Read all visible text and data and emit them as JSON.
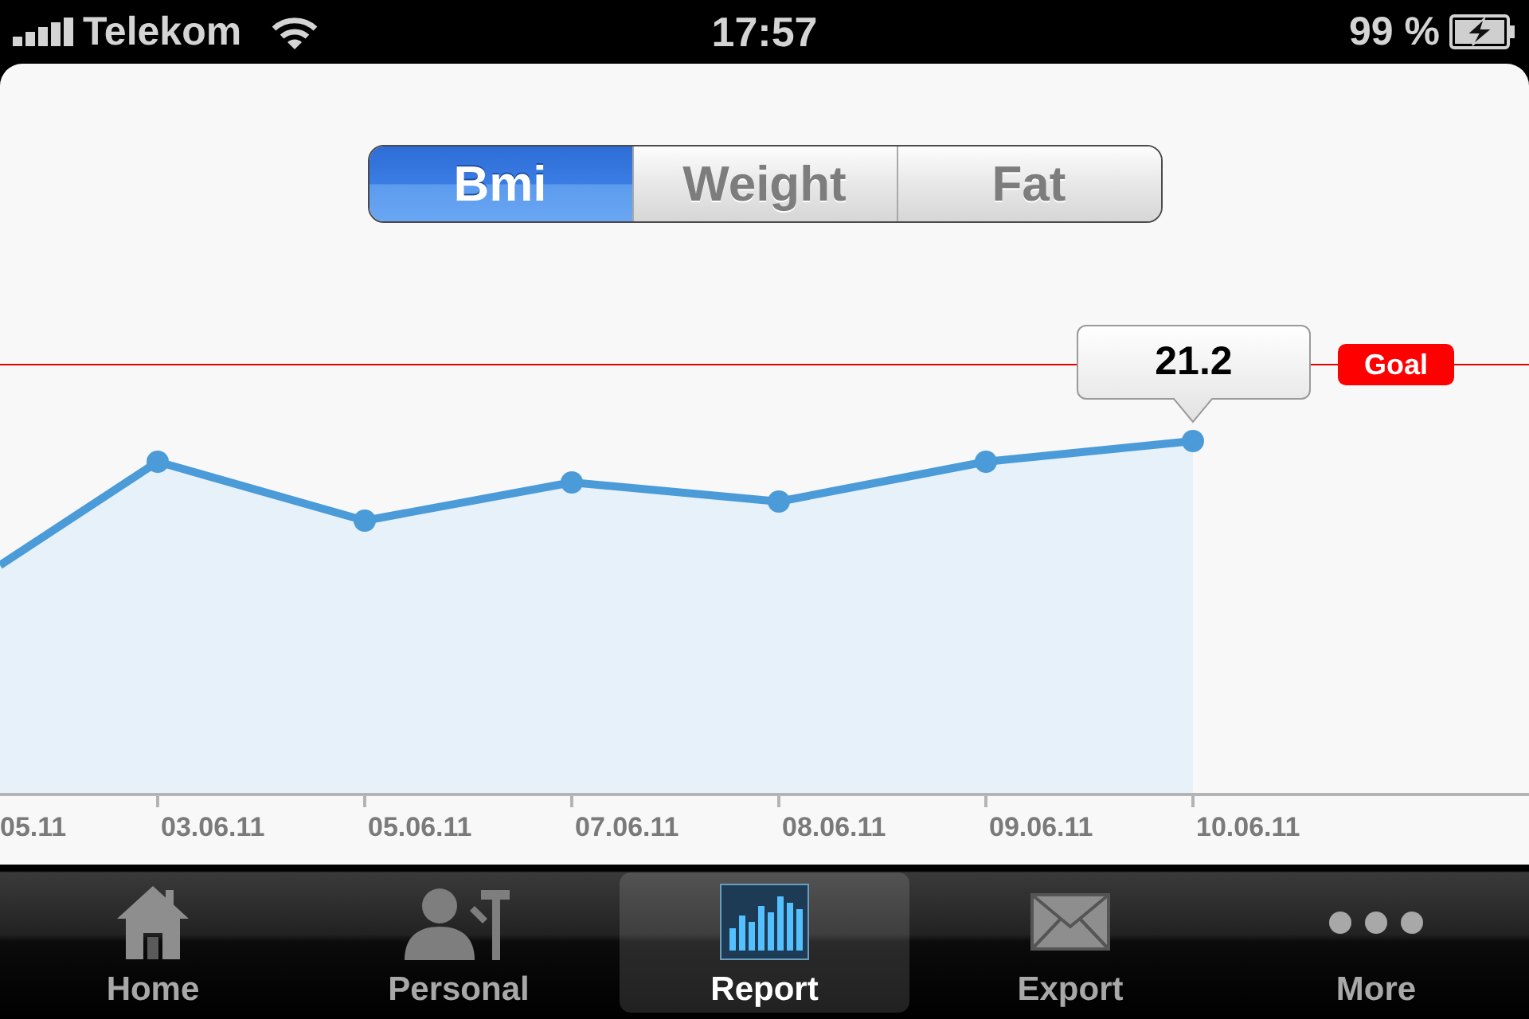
{
  "status_bar": {
    "carrier": "Telekom",
    "time": "17:57",
    "battery": "99 %",
    "charging": true
  },
  "segments": [
    {
      "label": "Bmi",
      "selected": true
    },
    {
      "label": "Weight",
      "selected": false
    },
    {
      "label": "Fat",
      "selected": false
    }
  ],
  "chart": {
    "callout": "21.2",
    "goal_label": "Goal",
    "x_labels": [
      "05.11",
      "03.06.11",
      "05.06.11",
      "07.06.11",
      "08.06.11",
      "09.06.11",
      "10.06.11"
    ]
  },
  "tab_bar": {
    "tabs": [
      {
        "label": "Home",
        "selected": false
      },
      {
        "label": "Personal",
        "selected": false
      },
      {
        "label": "Report",
        "selected": true
      },
      {
        "label": "Export",
        "selected": false
      },
      {
        "label": "More",
        "selected": false
      }
    ]
  }
}
